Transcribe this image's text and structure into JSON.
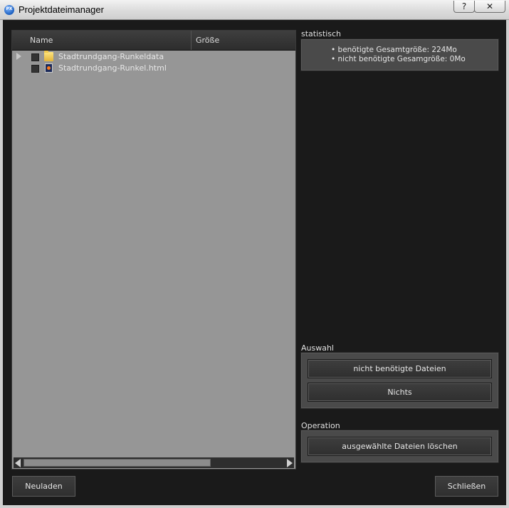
{
  "window": {
    "title": "Projektdateimanager",
    "help_label": "?",
    "close_label": "✕",
    "app_icon_text": "PX"
  },
  "tree": {
    "columns": {
      "name": "Name",
      "size": "Größe"
    },
    "items": [
      {
        "label": "Stadtrundgang-Runkeldata",
        "icon": "folder-icon",
        "expandable": true
      },
      {
        "label": "Stadtrundgang-Runkel.html",
        "icon": "html-file-icon",
        "expandable": false
      }
    ]
  },
  "stats": {
    "title": "statistisch",
    "lines": [
      "• benötigte Gesamtgröße: 224Mo",
      "• nicht benötigte Gesamgröße: 0Mo"
    ]
  },
  "selection": {
    "title": "Auswahl",
    "unneeded_label": "nicht benötigte Dateien",
    "none_label": "Nichts"
  },
  "operation": {
    "title": "Operation",
    "delete_label": "ausgewählte Dateien löschen"
  },
  "footer": {
    "reload_label": "Neuladen",
    "close_label": "Schließen"
  }
}
